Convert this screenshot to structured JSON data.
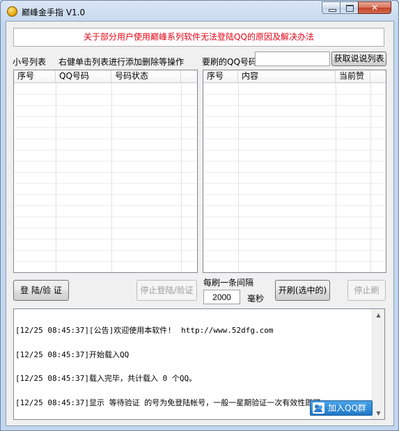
{
  "window": {
    "title": "巅峰金手指 V1.0"
  },
  "notice": "关于部分用户使用巅峰系列软件无法登陆QQ的原因及解决办法",
  "left": {
    "label": "小号列表",
    "hint": "右健单击列表进行添加删除等操作",
    "columns": [
      "序号",
      "QQ号码",
      "号码状态"
    ]
  },
  "right": {
    "qq_label": "要刷的QQ号码",
    "qq_value": "",
    "fetch_button": "获取说说列表",
    "columns": [
      "序号",
      "内容",
      "当前赞"
    ]
  },
  "controls": {
    "login_button": "登 陆/验 证",
    "stop_login_button": "停止登陆/验证",
    "interval_label": "每刷一条间隔",
    "interval_value": "2000",
    "interval_unit": "毫秒",
    "start_button": "开刷(选中的)",
    "stop_button": "停止刷"
  },
  "log": {
    "lines": [
      "[12/25 08:45:37][公告]欢迎使用本软件!  http://www.52dfg.com",
      "[12/25 08:45:37]开始载入QQ",
      "[12/25 08:45:37]载入完毕，共计载入 0 个QQ。",
      "[12/25 08:45:37]显示 等待验证 的号为免登陆帐号，一般一星期验证一次有效性即可"
    ]
  },
  "join_qq_group": "加入QQ群"
}
